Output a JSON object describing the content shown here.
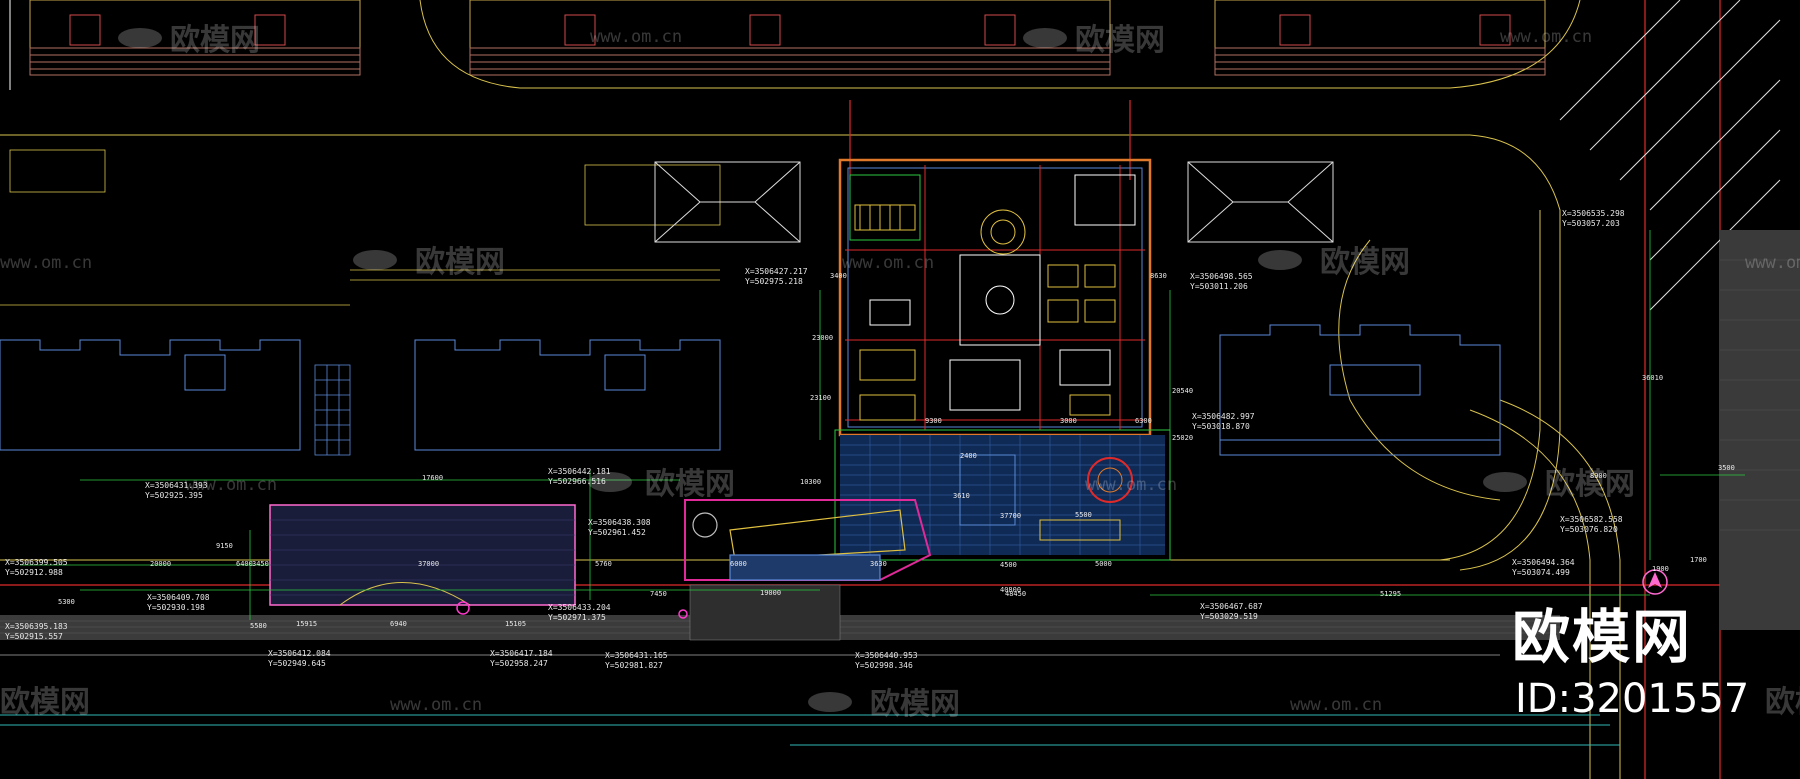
{
  "watermark": {
    "brand_cn": "欧模网",
    "url": "www.om.cn"
  },
  "brand": {
    "name_cn": "欧模网",
    "id_label": "ID:3201557"
  },
  "coordinates": [
    {
      "x": "X=3506427.217",
      "y": "Y=502975.218"
    },
    {
      "x": "X=3506498.565",
      "y": "Y=503011.206"
    },
    {
      "x": "X=3506482.997",
      "y": "Y=503018.870"
    },
    {
      "x": "X=3506535.298",
      "y": "Y=503057.203"
    },
    {
      "x": "X=3506431.393",
      "y": "Y=502925.395"
    },
    {
      "x": "X=3506442.181",
      "y": "Y=502966.516"
    },
    {
      "x": "X=3506438.308",
      "y": "Y=502961.452"
    },
    {
      "x": "X=3506399.505",
      "y": "Y=502912.988"
    },
    {
      "x": "X=3506409.708",
      "y": "Y=502930.198"
    },
    {
      "x": "X=3506395.183",
      "y": "Y=502915.557"
    },
    {
      "x": "X=3506433.204",
      "y": "Y=502971.375"
    },
    {
      "x": "X=3506412.084",
      "y": "Y=502949.645"
    },
    {
      "x": "X=3506417.184",
      "y": "Y=502958.247"
    },
    {
      "x": "X=3506431.165",
      "y": "Y=502981.827"
    },
    {
      "x": "X=3506440.953",
      "y": "Y=502998.346"
    },
    {
      "x": "X=3506467.687",
      "y": "Y=503029.519"
    },
    {
      "x": "X=3506494.364",
      "y": "Y=503074.499"
    },
    {
      "x": "X=3506582.558",
      "y": "Y=503076.820"
    }
  ],
  "dimensions": [
    "20000",
    "6400",
    "3450",
    "9150",
    "37000",
    "17600",
    "40800",
    "10300",
    "8900",
    "3400",
    "8630",
    "3500",
    "36010",
    "23100",
    "5760",
    "7450",
    "25020",
    "4500",
    "37700",
    "6000",
    "3630",
    "9300",
    "3000",
    "5000",
    "6300",
    "5500",
    "1700",
    "2400",
    "19000",
    "23000",
    "3610",
    "48450",
    "51295",
    "15915",
    "6940",
    "15105",
    "5300",
    "20540",
    "1900",
    "5580"
  ]
}
